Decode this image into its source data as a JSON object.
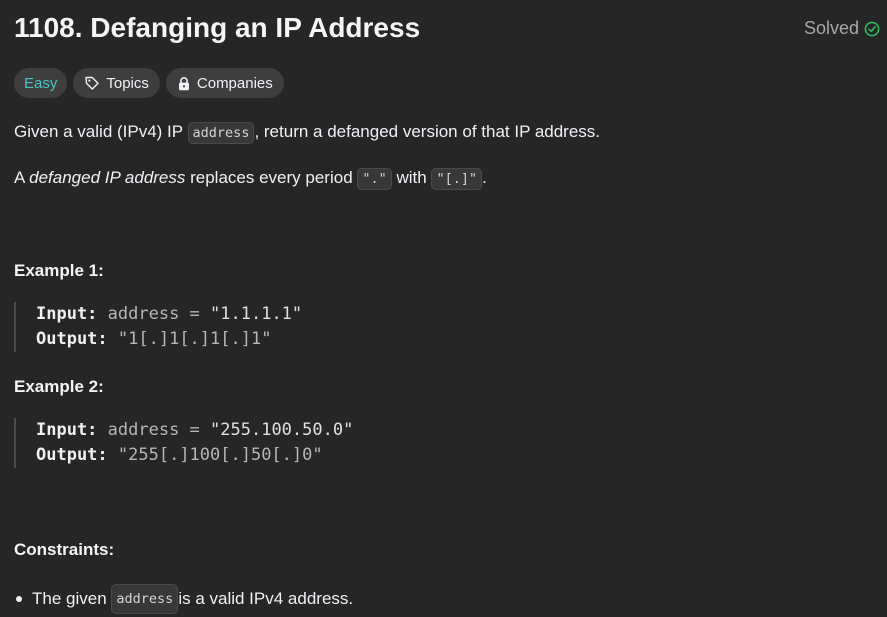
{
  "problem": {
    "title": "1108. Defanging an IP Address",
    "status": "Solved"
  },
  "tags": {
    "difficulty": "Easy",
    "topics": "Topics",
    "companies": "Companies"
  },
  "description": {
    "p1_a": "Given a valid (IPv4) IP ",
    "p1_code": "address",
    "p1_b": ", return a defanged version of that IP address.",
    "p2_a": "A ",
    "p2_em": "defanged IP address",
    "p2_b": " replaces every period ",
    "p2_code1": "\".\"",
    "p2_c": " with ",
    "p2_code2": "\"[.]\"",
    "p2_d": "."
  },
  "examples": [
    {
      "heading": "Example 1:",
      "input_label": "Input:",
      "input_value": "address = ",
      "input_string": "\"1.1.1.1\"",
      "output_label": "Output:",
      "output_value": "\"1[.]1[.]1[.]1\""
    },
    {
      "heading": "Example 2:",
      "input_label": "Input:",
      "input_value": "address = ",
      "input_string": "\"255.100.50.0\"",
      "output_label": "Output:",
      "output_value": "\"255[.]100[.]50[.]0\""
    }
  ],
  "constraints": {
    "heading": "Constraints:",
    "items": [
      {
        "a": "The given ",
        "code": "address",
        "b": " is a valid IPv4 address."
      }
    ]
  },
  "colors": {
    "background": "#262626",
    "easy": "#46c6c2",
    "solved_check": "#2cbb5d"
  }
}
